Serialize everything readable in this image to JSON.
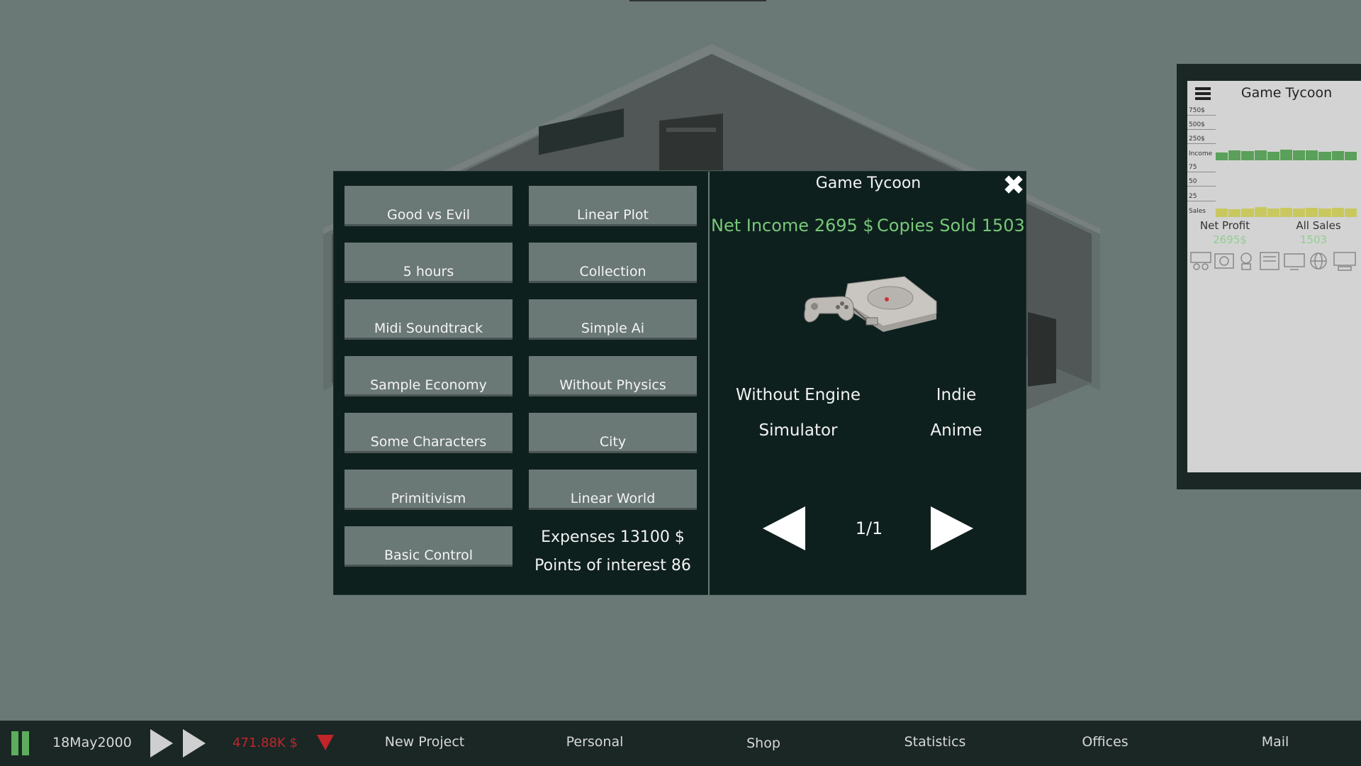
{
  "dialog": {
    "features_left": [
      "Good vs Evil",
      "5 hours",
      "Midi Soundtrack",
      "Sample Economy",
      "Some Characters",
      "Primitivism",
      "Basic Control"
    ],
    "features_right": [
      "Linear Plot",
      "Collection",
      "Simple Ai",
      "Without Physics",
      "City",
      "Linear World"
    ],
    "expenses": "Expenses 13100 $",
    "points_of_interest": "Points of interest 86",
    "title": "Game Tycoon",
    "net_income": "Net Income 2695 $",
    "copies_sold": "Copies Sold 1503",
    "attributes": {
      "engine": "Without Engine",
      "size": "Indie",
      "genre": "Simulator",
      "theme": "Anime"
    },
    "page_indicator": "1/1",
    "icons": {
      "close": "close-icon",
      "console": "game-console-icon",
      "prev": "arrow-left-icon",
      "next": "arrow-right-icon"
    }
  },
  "stats_panel": {
    "title": "Game Tycoon",
    "income_ticks": [
      "750$",
      "500$",
      "250$",
      "Income"
    ],
    "sales_ticks": [
      "75",
      "50",
      "25",
      "Sales"
    ],
    "income_values": [
      0.55,
      0.7,
      0.65,
      0.72,
      0.6,
      0.75,
      0.68,
      0.7,
      0.62,
      0.66,
      0.58
    ],
    "sales_values": [
      0.6,
      0.55,
      0.62,
      0.7,
      0.58,
      0.66,
      0.6,
      0.64,
      0.59,
      0.63,
      0.6
    ],
    "net_profit_label": "Net Profit",
    "net_profit_value": "2695$",
    "all_sales_label": "All Sales",
    "all_sales_value": "1503",
    "colors": {
      "income_bar": "#5aa05a",
      "sales_bar": "#c9c85e",
      "value": "#8fcf8f"
    }
  },
  "taskbar": {
    "date": "18May2000",
    "money": "471.88K $",
    "nav": [
      "New Project",
      "Personal",
      "Shop",
      "Statistics",
      "Offices",
      "Mail"
    ],
    "colors": {
      "money": "#c0252a",
      "pause": "#5cae5c"
    }
  }
}
